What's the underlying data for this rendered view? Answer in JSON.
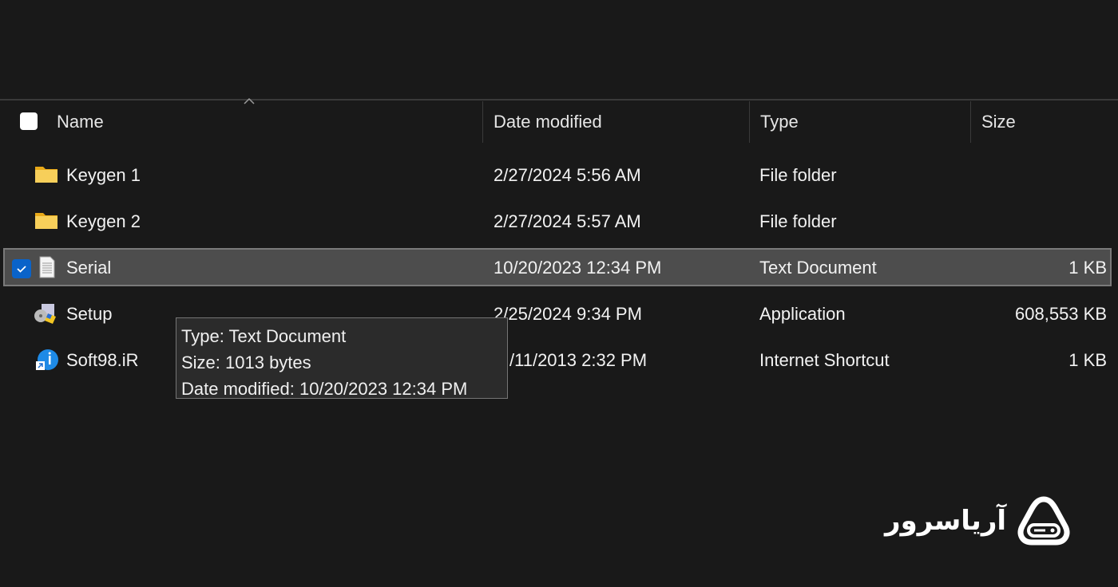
{
  "columns": {
    "name": "Name",
    "date": "Date modified",
    "type": "Type",
    "size": "Size"
  },
  "files": [
    {
      "name": "Keygen 1",
      "date": "2/27/2024 5:56 AM",
      "type": "File folder",
      "size": "",
      "icon": "folder-icon"
    },
    {
      "name": "Keygen 2",
      "date": "2/27/2024 5:57 AM",
      "type": "File folder",
      "size": "",
      "icon": "folder-icon"
    },
    {
      "name": "Serial",
      "date": "10/20/2023 12:34 PM",
      "type": "Text Document",
      "size": "1 KB",
      "icon": "text-document-icon",
      "selected": true
    },
    {
      "name": "Setup",
      "date": "2/25/2024 9:34 PM",
      "type": "Application",
      "size": "608,553 KB",
      "icon": "installer-icon"
    },
    {
      "name": "Soft98.iR",
      "date": "/11/2013 2:32 PM",
      "type": "Internet Shortcut",
      "size": "1 KB",
      "icon": "internet-shortcut-icon"
    }
  ],
  "tooltip": {
    "type": "Type: Text Document",
    "size": "Size: 1013 bytes",
    "date": "Date modified: 10/20/2023 12:34 PM"
  },
  "logo": {
    "text": "آریاسرور"
  },
  "colors": {
    "background": "#191919",
    "selection": "#4d4d4d",
    "checkbox_accent": "#0a63c9",
    "folder": "#f5c542"
  }
}
